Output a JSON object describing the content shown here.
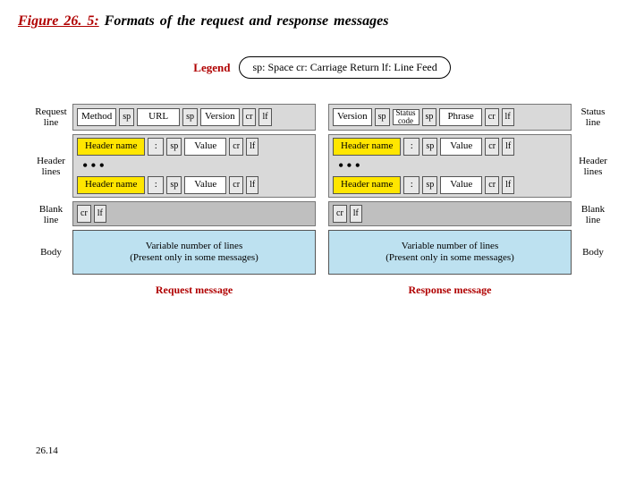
{
  "title_prefix": "Figure 26. 5:",
  "title_rest": "Formats of the request and response messages",
  "legend_label": "Legend",
  "legend_text": "sp: Space   cr: Carriage Return   lf: Line Feed",
  "left_labels": {
    "request_line_a": "Request",
    "request_line_b": "line",
    "header_a": "Header",
    "header_b": "lines",
    "blank_a": "Blank",
    "blank_b": "line",
    "body": "Body"
  },
  "right_labels": {
    "status_line_a": "Status",
    "status_line_b": "line",
    "header_a": "Header",
    "header_b": "lines",
    "blank_a": "Blank",
    "blank_b": "line",
    "body": "Body"
  },
  "tokens": {
    "method": "Method",
    "sp": "sp",
    "url": "URL",
    "version": "Version",
    "cr": "cr",
    "lf": "lf",
    "status_code": "Status\ncode",
    "phrase": "Phrase",
    "header_name": "Header name",
    "colon": ":",
    "value": "Value"
  },
  "body_text_line1": "Variable number of lines",
  "body_text_line2": "(Present only in some messages)",
  "caption_left": "Request message",
  "caption_right": "Response message",
  "page_number": "26.14",
  "chart_data": {
    "type": "diagram",
    "title": "Formats of the request and response messages",
    "legend": {
      "sp": "Space",
      "cr": "Carriage Return",
      "lf": "Line Feed"
    },
    "request_message": {
      "request_line": [
        "Method",
        "sp",
        "URL",
        "sp",
        "Version",
        "cr",
        "lf"
      ],
      "header_lines": {
        "repeats": true,
        "pattern": [
          "Header name",
          ":",
          "sp",
          "Value",
          "cr",
          "lf"
        ]
      },
      "blank_line": [
        "cr",
        "lf"
      ],
      "body": "Variable number of lines (Present only in some messages)"
    },
    "response_message": {
      "status_line": [
        "Version",
        "sp",
        "Status code",
        "sp",
        "Phrase",
        "cr",
        "lf"
      ],
      "header_lines": {
        "repeats": true,
        "pattern": [
          "Header name",
          ":",
          "sp",
          "Value",
          "cr",
          "lf"
        ]
      },
      "blank_line": [
        "cr",
        "lf"
      ],
      "body": "Variable number of lines (Present only in some messages)"
    }
  }
}
